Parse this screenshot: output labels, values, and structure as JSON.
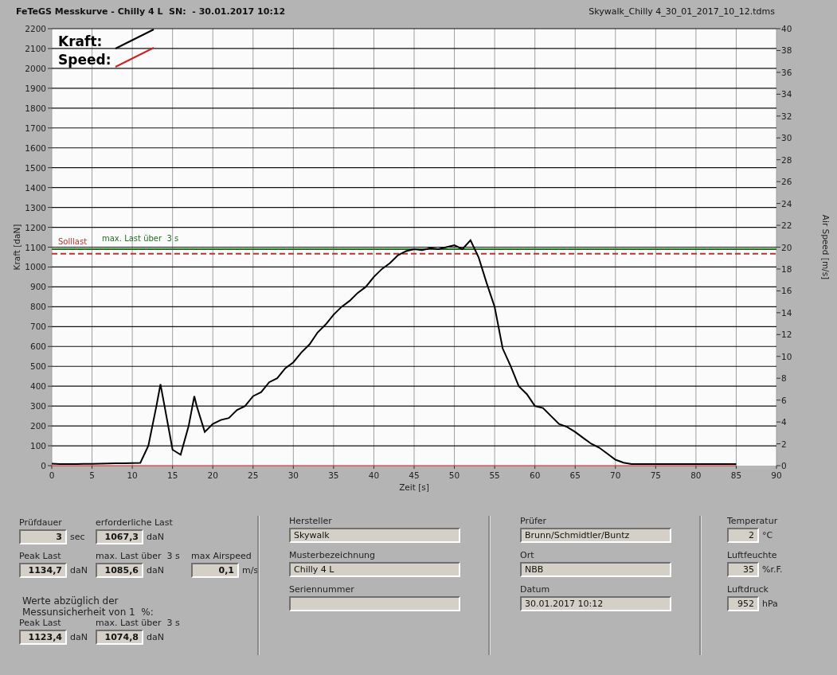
{
  "header": {
    "title": "FeTeGS Messkurve - Chilly 4 L  SN:  - 30.01.2017 10:12",
    "file": "Skywalk_Chilly 4_30_01_2017_10_12.tdms"
  },
  "chart": {
    "chart_data": {
      "type": "line",
      "xlabel": "Zeit [s]",
      "ylabel": "Kraft [daN]",
      "y2label": "Air Speed [m/s]",
      "x": [
        0,
        1,
        2,
        3,
        4,
        5,
        6,
        7,
        8,
        9,
        10,
        11,
        12,
        13,
        13.5,
        14,
        15,
        16,
        17,
        17.7,
        18,
        19,
        20,
        21,
        22,
        23,
        24,
        25,
        26,
        27,
        28,
        29,
        30,
        31,
        32,
        33,
        34,
        35,
        36,
        37,
        38,
        39,
        40,
        41,
        42,
        43,
        44,
        45,
        46,
        47,
        48,
        49,
        50,
        51,
        52,
        53,
        54,
        55,
        56,
        57,
        58,
        59,
        60,
        61,
        62,
        63,
        64,
        65,
        66,
        67,
        68,
        69,
        70,
        71,
        72,
        73,
        75,
        80,
        85
      ],
      "series": [
        {
          "name": "Kraft:",
          "color": "#000000",
          "values": [
            10,
            8,
            8,
            8,
            9,
            9,
            10,
            11,
            12,
            12,
            13,
            14,
            100,
            300,
            410,
            300,
            80,
            55,
            200,
            350,
            300,
            170,
            210,
            230,
            240,
            280,
            300,
            350,
            370,
            420,
            440,
            490,
            520,
            570,
            610,
            670,
            710,
            760,
            800,
            830,
            870,
            900,
            950,
            990,
            1020,
            1060,
            1080,
            1090,
            1085,
            1095,
            1090,
            1100,
            1110,
            1090,
            1135,
            1050,
            920,
            800,
            590,
            500,
            400,
            360,
            300,
            290,
            250,
            210,
            195,
            170,
            140,
            110,
            90,
            60,
            30,
            15,
            8,
            8,
            8,
            8,
            8
          ]
        },
        {
          "name": "Speed:",
          "color": "#d02020",
          "values": [
            0,
            0,
            0,
            0,
            0,
            0,
            0,
            0,
            0,
            0,
            0,
            0,
            0,
            0,
            0,
            0,
            0,
            0,
            0,
            0,
            0,
            0,
            0,
            0,
            0,
            0,
            0,
            0,
            0,
            0,
            0,
            0,
            0,
            0,
            0,
            0,
            0,
            0,
            0,
            0,
            0,
            0,
            0,
            0,
            0,
            0,
            0,
            0,
            0,
            0,
            0,
            0,
            0,
            0,
            0,
            0,
            0,
            0,
            0,
            0,
            0,
            0,
            0,
            0,
            0,
            0,
            0,
            0,
            0,
            0,
            0,
            0,
            0,
            0,
            0,
            0,
            0,
            0,
            0
          ]
        }
      ],
      "xlim": [
        0,
        90
      ],
      "ylim": [
        0,
        2200
      ],
      "xticks": [
        0,
        5,
        10,
        15,
        20,
        25,
        30,
        35,
        40,
        45,
        50,
        55,
        60,
        65,
        70,
        75,
        80,
        85,
        90
      ],
      "yticks": [
        0,
        100,
        200,
        300,
        400,
        500,
        600,
        700,
        800,
        900,
        1000,
        1100,
        1200,
        1300,
        1400,
        1500,
        1600,
        1700,
        1800,
        1900,
        2000,
        2100,
        2200
      ],
      "y2lim": [
        0,
        40
      ],
      "y2ticks": [
        0,
        2,
        4,
        6,
        8,
        10,
        12,
        14,
        16,
        18,
        20,
        22,
        24,
        26,
        28,
        30,
        32,
        34,
        36,
        38,
        40
      ],
      "grid": true,
      "legend": true,
      "ref_lines": [
        {
          "axis": "y",
          "value": 1067.3,
          "label": "Solllast",
          "color": "#c03030"
        },
        {
          "axis": "y",
          "value": 1090,
          "label": "max. Last über  3 s",
          "color": "#207020"
        }
      ]
    }
  },
  "results": {
    "fields": [
      {
        "label": "Prüfdauer",
        "value": "3",
        "unit": "sec"
      },
      {
        "label": "erforderliche Last",
        "value": "1067,3",
        "unit": "daN"
      },
      {
        "label": "Peak Last",
        "value": "1134,7",
        "unit": "daN"
      },
      {
        "label": "max. Last über  3 s",
        "value": "1085,6",
        "unit": "daN"
      },
      {
        "label": "max Airspeed",
        "value": "0,1",
        "unit": "m/s"
      }
    ],
    "note": "Werte abzüglich der\nMessunsicherheit von 1  %:",
    "corrected_fields": [
      {
        "label": "Peak Last",
        "value": "1123,4",
        "unit": "daN"
      },
      {
        "label": "max. Last über  3 s",
        "value": "1074,8",
        "unit": "daN"
      }
    ]
  },
  "glider": [
    {
      "label": "Hersteller",
      "value": "Skywalk"
    },
    {
      "label": "Musterbezeichnung",
      "value": "Chilly 4 L"
    },
    {
      "label": "Seriennummer"
    }
  ],
  "test": [
    {
      "label": "Prüfer",
      "value": "Brunn/Schmidtler/Buntz"
    },
    {
      "label": "Ort",
      "value": "NBB"
    },
    {
      "label": "Datum",
      "value": "30.01.2017 10:12"
    }
  ],
  "environment": [
    {
      "label": "Temperatur",
      "value": "2",
      "unit": "°C"
    },
    {
      "label": "Luftfeuchte",
      "value": "35",
      "unit": "%r.F."
    },
    {
      "label": "Luftdruck",
      "value": "952",
      "unit": "hPa"
    }
  ]
}
